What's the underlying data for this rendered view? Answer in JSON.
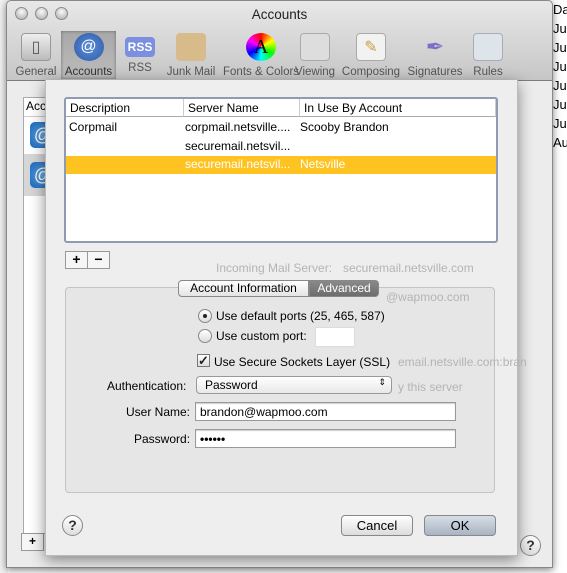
{
  "window": {
    "title": "Accounts"
  },
  "toolbar": [
    {
      "label": "General",
      "icon": "switch-icon"
    },
    {
      "label": "Accounts",
      "icon": "at-icon",
      "selected": true
    },
    {
      "label": "RSS",
      "icon": "rss-icon"
    },
    {
      "label": "Junk Mail",
      "icon": "junk-mail-icon"
    },
    {
      "label": "Fonts & Colors",
      "icon": "fonts-colors-icon"
    },
    {
      "label": "Viewing",
      "icon": "viewing-icon"
    },
    {
      "label": "Composing",
      "icon": "composing-icon"
    },
    {
      "label": "Signatures",
      "icon": "signatures-icon"
    },
    {
      "label": "Rules",
      "icon": "rules-icon"
    }
  ],
  "background": {
    "accounts_header": "Acc",
    "right_column": [
      "Da",
      "Ju",
      "Ju",
      "Ju",
      "Ju",
      "Ju",
      "Ju",
      "Au"
    ],
    "ghost": {
      "incoming": "Incoming Mail Server:",
      "incoming_value": "securemail.netsville.com",
      "user": "@wapmoo.com",
      "outgoing": "email.netsville.com:bran",
      "this_server": "y this server"
    }
  },
  "sheet": {
    "columns": [
      "Description",
      "Server Name",
      "In Use By Account"
    ],
    "rows": [
      {
        "description": "Corpmail",
        "server": "corpmail.netsville....",
        "account": "Scooby Brandon",
        "selected": false
      },
      {
        "description": "",
        "server": "securemail.netsvil...",
        "account": "",
        "selected": false
      },
      {
        "description": "",
        "server": "securemail.netsvil...",
        "account": "Netsville",
        "selected": true
      }
    ],
    "add_label": "+",
    "remove_label": "−",
    "tabs": [
      {
        "label": "Account Information",
        "active": false
      },
      {
        "label": "Advanced",
        "active": true
      }
    ],
    "ports": {
      "default_label": "Use default ports (25, 465, 587)",
      "custom_label": "Use custom port:",
      "selected": "default",
      "custom_value": ""
    },
    "ssl": {
      "label": "Use Secure Sockets Layer (SSL)",
      "checked": true
    },
    "authentication": {
      "label": "Authentication:",
      "value": "Password"
    },
    "username": {
      "label": "User Name:",
      "value": "brandon@wapmoo.com"
    },
    "password": {
      "label": "Password:",
      "value": "••••••"
    },
    "help": "?",
    "cancel": "Cancel",
    "ok": "OK",
    "selection_color": "#fec221"
  }
}
